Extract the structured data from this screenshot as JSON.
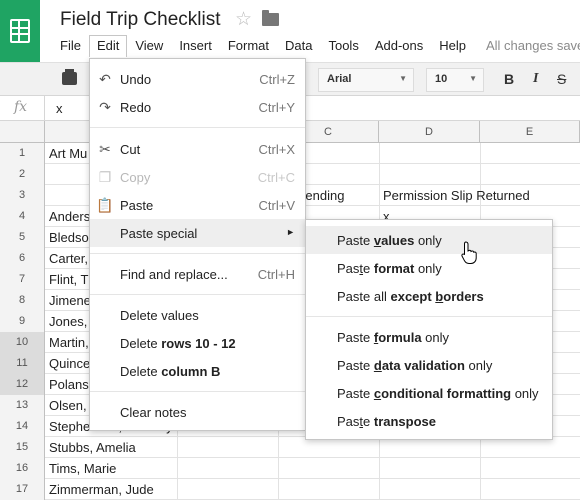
{
  "app": {
    "doc_title": "Field Trip Checklist",
    "saved_status": "All changes save"
  },
  "menubar": [
    "File",
    "Edit",
    "View",
    "Insert",
    "Format",
    "Data",
    "Tools",
    "Add-ons",
    "Help"
  ],
  "toolbar": {
    "font": "Arial",
    "font_size": "10",
    "bold": "B",
    "italic": "I",
    "strike": "S"
  },
  "formula_bar": {
    "fx": "fx",
    "value": "x"
  },
  "columns": [
    "C",
    "D",
    "E"
  ],
  "rows": [
    {
      "num": "1",
      "a": "Art Mu",
      "c": "",
      "d": ""
    },
    {
      "num": "2",
      "a": "",
      "c": "",
      "d": ""
    },
    {
      "num": "3",
      "a": "",
      "c": "t Attending",
      "d": "Permission Slip Returned"
    },
    {
      "num": "4",
      "a": "Anders",
      "c": "",
      "d": "x"
    },
    {
      "num": "5",
      "a": "Bledso",
      "c": "",
      "d": ""
    },
    {
      "num": "6",
      "a": "Carter,",
      "c": "",
      "d": ""
    },
    {
      "num": "7",
      "a": "Flint, T",
      "c": "",
      "d": ""
    },
    {
      "num": "8",
      "a": "Jimene",
      "c": "",
      "d": ""
    },
    {
      "num": "9",
      "a": "Jones,",
      "c": "",
      "d": ""
    },
    {
      "num": "10",
      "a": "Martin,",
      "c": "",
      "d": ""
    },
    {
      "num": "11",
      "a": "Quince",
      "c": "",
      "d": ""
    },
    {
      "num": "12",
      "a": "Polans",
      "c": "",
      "d": ""
    },
    {
      "num": "13",
      "a": "Olsen,",
      "c": "",
      "d": ""
    },
    {
      "num": "14",
      "a": "Stephenson, Anthony",
      "c": "",
      "d": ""
    },
    {
      "num": "15",
      "a": "Stubbs, Amelia",
      "c": "",
      "d": ""
    },
    {
      "num": "16",
      "a": "Tims, Marie",
      "c": "",
      "d": ""
    },
    {
      "num": "17",
      "a": "Zimmerman, Jude",
      "c": "",
      "d": ""
    }
  ],
  "edit_menu": {
    "undo": {
      "label": "Undo",
      "shortcut": "Ctrl+Z"
    },
    "redo": {
      "label": "Redo",
      "shortcut": "Ctrl+Y"
    },
    "cut": {
      "label": "Cut",
      "shortcut": "Ctrl+X"
    },
    "copy": {
      "label": "Copy",
      "shortcut": "Ctrl+C"
    },
    "paste": {
      "label": "Paste",
      "shortcut": "Ctrl+V"
    },
    "paste_special": {
      "label": "Paste special"
    },
    "find_replace": {
      "label": "Find and replace...",
      "shortcut": "Ctrl+H"
    },
    "delete_values": {
      "label": "Delete values"
    },
    "delete_rows": {
      "prefix": "Delete ",
      "bold": "rows 10 - 12"
    },
    "delete_column": {
      "prefix": "Delete ",
      "bold": "column B"
    },
    "clear_notes": {
      "label": "Clear notes"
    }
  },
  "paste_special_menu": {
    "values_only": {
      "p1": "Paste ",
      "bold_u": "v",
      "bold": "alues",
      "p2": " only"
    },
    "format_only": {
      "p1": "Pas",
      "u": "t",
      "p1b": "e ",
      "bold": "format",
      "p2": " only"
    },
    "all_except_borders": {
      "p1": "Paste all ",
      "bold": "except ",
      "bold_u": "b",
      "bold2": "orders"
    },
    "formula_only": {
      "p1": "Paste ",
      "bold_u": "f",
      "bold": "ormula",
      "p2": " only"
    },
    "data_validation_only": {
      "p1": "Paste ",
      "bold_u": "d",
      "bold": "ata validation",
      "p2": " only"
    },
    "conditional_formatting_only": {
      "p1": "Paste ",
      "bold_u": "c",
      "bold": "onditional formatting",
      "p2": " only"
    },
    "transpose": {
      "p1": "Pas",
      "u": "t",
      "p1b": "e ",
      "bold": "transpose"
    }
  },
  "colors": {
    "logo_green": "#1fa463",
    "highlight": "#eeeeee"
  }
}
